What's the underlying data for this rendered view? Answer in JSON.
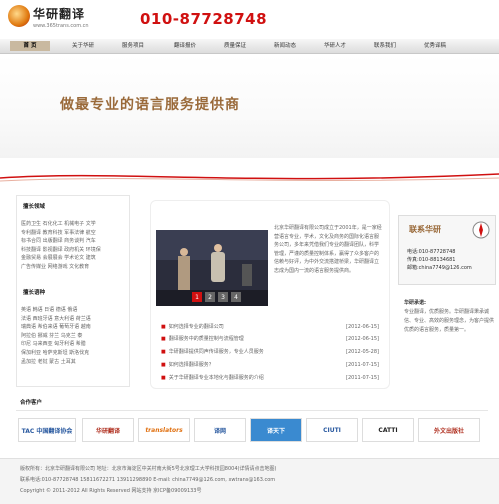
{
  "header": {
    "brand_name": "华研翻译",
    "url": "www.365trans.com.cn",
    "phone": "010-87728748"
  },
  "nav": [
    {
      "label": "首 页",
      "active": true
    },
    {
      "label": "关于华研"
    },
    {
      "label": "服务项目"
    },
    {
      "label": "翻译报价"
    },
    {
      "label": "质量保证"
    },
    {
      "label": "新闻动态"
    },
    {
      "label": "华研人才"
    },
    {
      "label": "联系我们"
    },
    {
      "label": "优秀译稿"
    }
  ],
  "banner": {
    "slogan": "做最专业的语言服务提供商"
  },
  "left": {
    "section1_title": "擅长领域",
    "section1_rows": [
      "医药卫生 石化化工 机械电子 文学",
      "专利翻译 教育科技 军事法律 航空",
      "标书合同 出版翻译 商务谈判 汽车",
      "科技翻译 影视翻译 政府机关 环境保",
      "金融贸易 会展展会 学术论文 建筑",
      "广告传媒业 网络游戏 文化教育"
    ],
    "section2_title": "擅长语种",
    "section2_rows": [
      "英语  韩语  日语  德语  俄语",
      "法语  西班牙语  意大利语  荷兰语",
      "瑞典语  希伯来语  葡萄牙语  越南",
      "阿拉伯  挪威  芬兰  乌克兰  泰",
      "印尼  马来西亚  匈牙利语  希腊",
      "保加利亚  哈萨克斯坦 斯洛伐克",
      "孟加拉  老挝  蒙古  土耳其"
    ]
  },
  "center": {
    "intro_text": "北京华研翻译有限公司成立于2001年，是一家经营语言专业，学术，文化及商务的国际化语言服务公司，多年来凭借我们专业的翻译团队，科学管理，严谨的质量控制体系，赢得了众多客户的信赖与好评，为中外交流搭建桥梁，华研翻译立志成为国内一流的语言服务提供商。",
    "photo_tabs": [
      "1",
      "2",
      "3",
      "4"
    ],
    "news": [
      {
        "title": "如何选择专业的翻译公司",
        "date": "[2012-06-15]"
      },
      {
        "title": "翻译服务中的质量控制与流程管理",
        "date": "[2012-06-15]"
      },
      {
        "title": "华研翻译提供同声传译服务，专业人员服务",
        "date": "[2012-05-28]"
      },
      {
        "title": "如何选择翻译服务？",
        "date": "[2011-07-15]"
      },
      {
        "title": "关于华研翻译专业本地化与翻译服务的介绍",
        "date": "[2011-07-15]"
      }
    ]
  },
  "right": {
    "card_title": "联系华研",
    "card_lines": [
      "电话:010-87728748",
      "传真:010-88134681",
      "邮箱:china7749@126.com"
    ],
    "text_title": "华研承诺:",
    "text": "专业翻译，优质服务。华研翻译秉承诚信、专业、高效的服务理念，为客户提供优质的语言服务，质量第一。"
  },
  "partners": {
    "title": "合作客户",
    "logos": [
      "TAC 中国翻译协会",
      "华研翻译",
      "translators",
      "译网",
      "译天下",
      "CIUTI",
      "CATTI",
      "外文出版社"
    ]
  },
  "footer": {
    "line1": "版权所有：北京华研翻译有限公司  地址：北京市海淀区中关村南大街5号北京理工大学科技园8004(详情请点击地图)",
    "line2": "联系电话:010-87728748  15811672271  13911298890  E-mail: china7749@126.com, xwtrans@163.com",
    "line3": "Copyright © 2011-2012 All Rights Reserved  网站支持  京ICP备09009133号"
  },
  "colors": {
    "accent_red": "#d01010",
    "slogan_brown": "#9a6a3a",
    "nav_active": "#c9b9a0"
  }
}
